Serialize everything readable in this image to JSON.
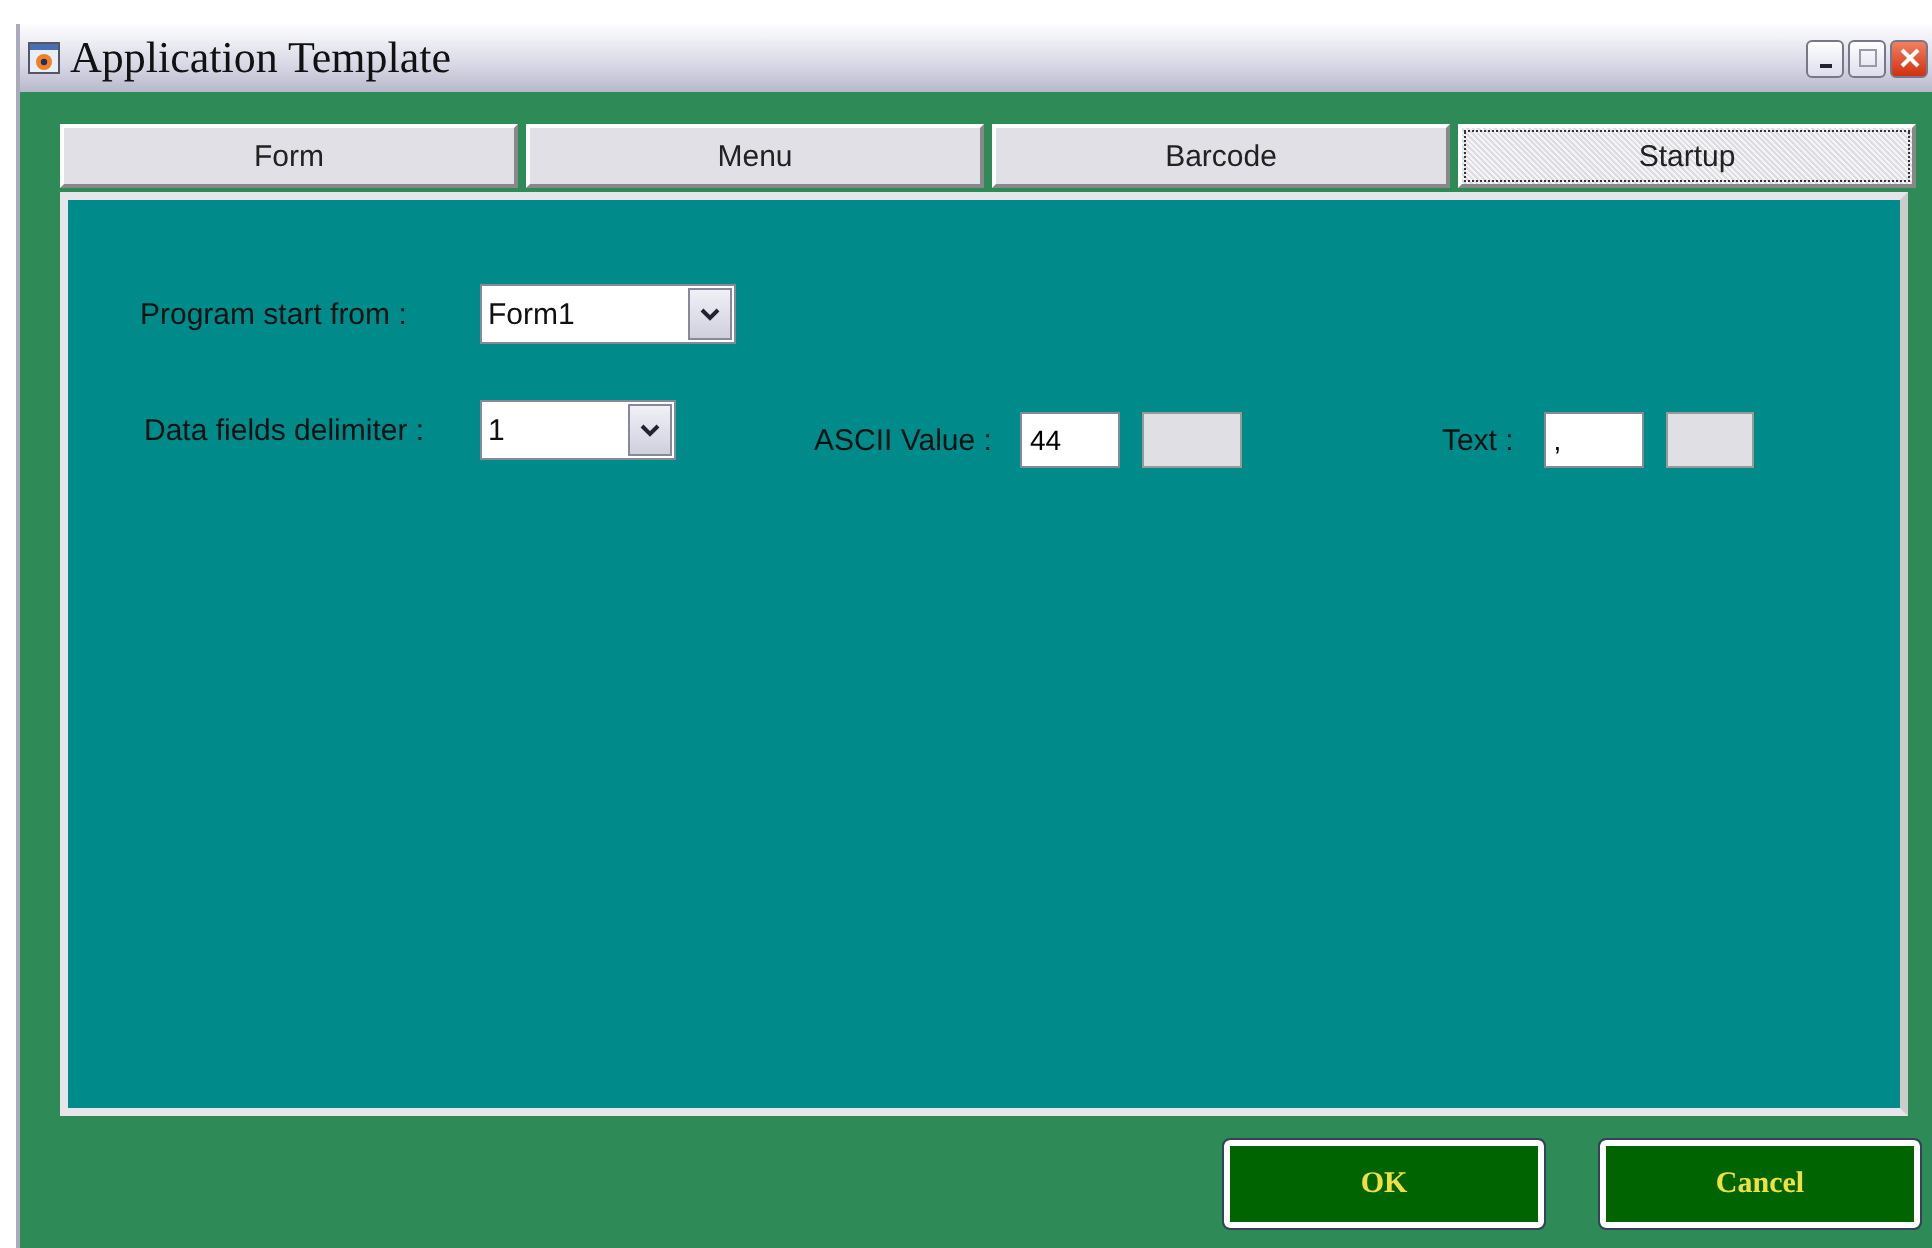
{
  "window": {
    "title": "Application Template"
  },
  "tabs": [
    {
      "label": "Form",
      "selected": false
    },
    {
      "label": "Menu",
      "selected": false
    },
    {
      "label": "Barcode",
      "selected": false
    },
    {
      "label": "Startup",
      "selected": true
    }
  ],
  "program_start": {
    "label": "Program start from :",
    "value": "Form1"
  },
  "delimiter": {
    "label": "Data fields delimiter :",
    "value": "1"
  },
  "ascii_value": {
    "label": "ASCII Value :",
    "value": "44"
  },
  "text": {
    "label": "Text :",
    "value": ","
  },
  "buttons": [
    "OK",
    "Cancel"
  ]
}
